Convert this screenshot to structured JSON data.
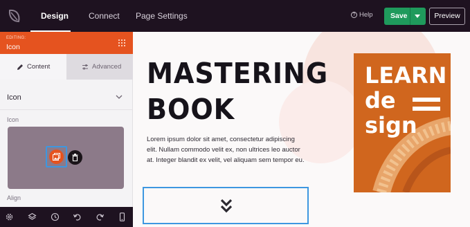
{
  "topbar": {
    "tabs": [
      {
        "label": "Design",
        "active": true
      },
      {
        "label": "Connect",
        "active": false
      },
      {
        "label": "Page Settings",
        "active": false
      }
    ],
    "help_label": "Help",
    "help_glyph": "?",
    "save_label": "Save",
    "preview_label": "Preview",
    "colors": {
      "bar": "#1e1220",
      "save": "#1f9a5c"
    }
  },
  "panel": {
    "editing_label": "EDITING:",
    "editing_title": "Icon",
    "tabs": [
      {
        "label": "Content",
        "active": true
      },
      {
        "label": "Advanced",
        "active": false
      }
    ],
    "section_title": "Icon",
    "field_icon_label": "Icon",
    "field_align_label": "Align",
    "colors": {
      "header": "#e5531f"
    }
  },
  "bottom_toolbar": {
    "icons": [
      "settings-icon",
      "layers-icon",
      "history-icon",
      "undo-icon",
      "redo-icon",
      "mobile-preview-icon"
    ]
  },
  "canvas": {
    "headline_line1": "MASTERING",
    "headline_line2": "BOOK",
    "body": "Lorem ipsum dolor sit amet, consectetur adipiscing elit. Nullam commodo velit ex, non ultrices leo auctor at. Integer blandit ex velit, vel aliquam sem tempor eu.",
    "book": {
      "line1": "LEARN",
      "line2": "de",
      "line3": "sign",
      "color": "#d0661e"
    },
    "selection_color": "#3d97e0"
  }
}
